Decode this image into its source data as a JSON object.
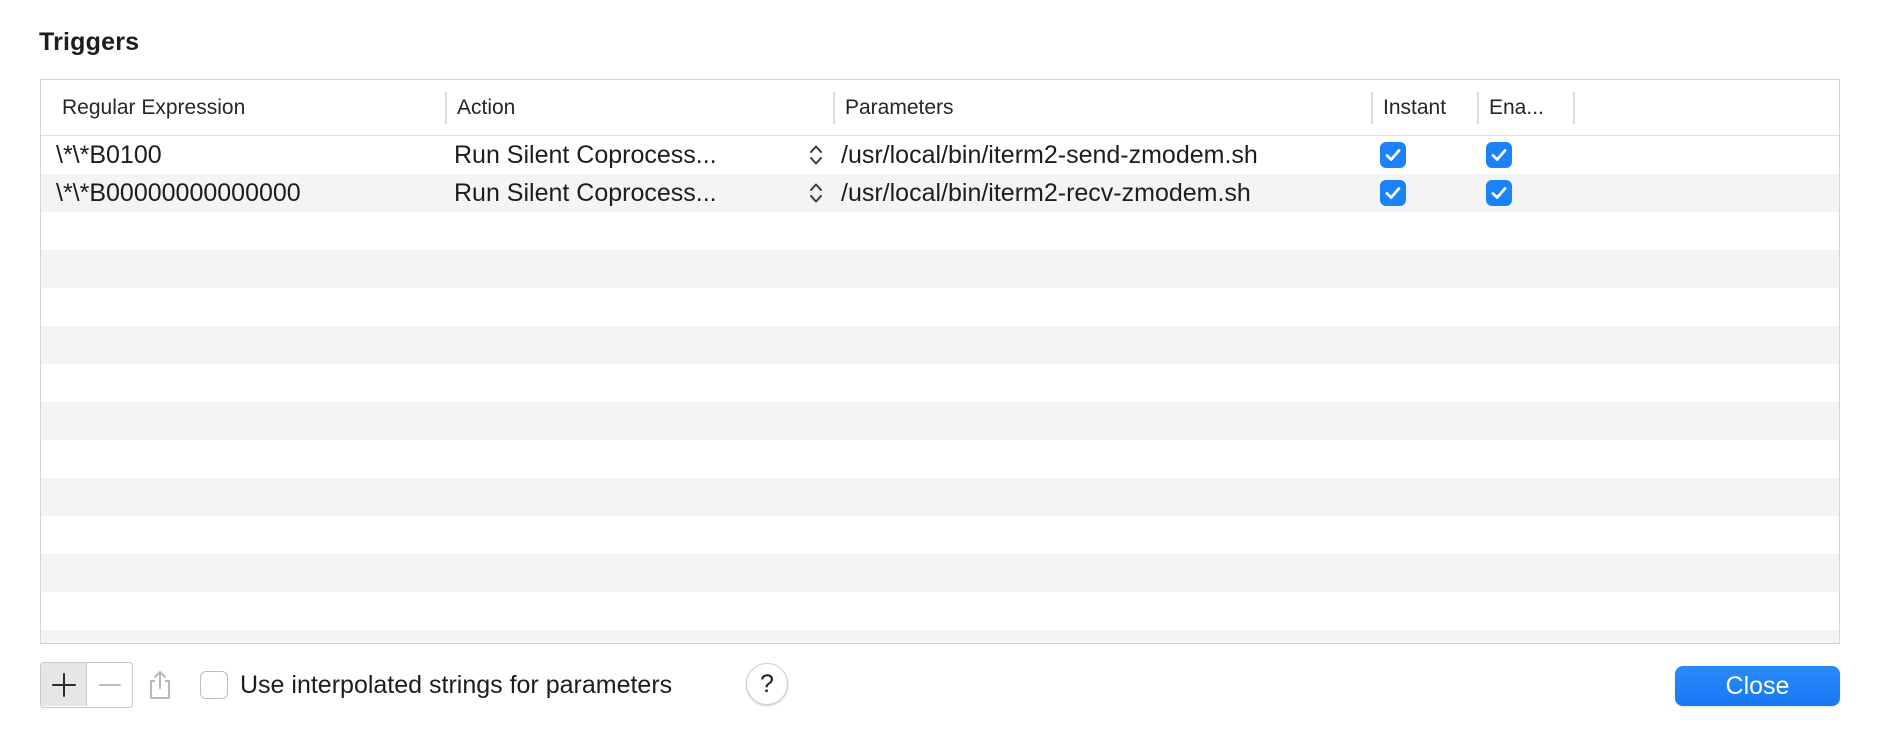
{
  "window": {
    "title": "Triggers"
  },
  "table": {
    "columns": [
      "Regular Expression",
      "Action",
      "Parameters",
      "Instant",
      "Ena..."
    ],
    "rows": [
      {
        "regex": "\\*\\*B0100",
        "action": "Run Silent Coprocess...",
        "parameters": "/usr/local/bin/iterm2-send-zmodem.sh",
        "instant": true,
        "enabled": true
      },
      {
        "regex": "\\*\\*B00000000000000",
        "action": "Run Silent Coprocess...",
        "parameters": "/usr/local/bin/iterm2-recv-zmodem.sh",
        "instant": true,
        "enabled": true
      }
    ],
    "empty_rows": 11
  },
  "footer": {
    "add_icon": "plus-icon",
    "remove_icon": "minus-icon",
    "share_icon": "share-icon",
    "interpolated_label": "Use interpolated strings for parameters",
    "interpolated_checked": false,
    "help_label": "?",
    "close_label": "Close"
  },
  "colors": {
    "accent": "#1a82fb",
    "alt_row": "#f4f4f4",
    "border": "#d4d4d4"
  }
}
